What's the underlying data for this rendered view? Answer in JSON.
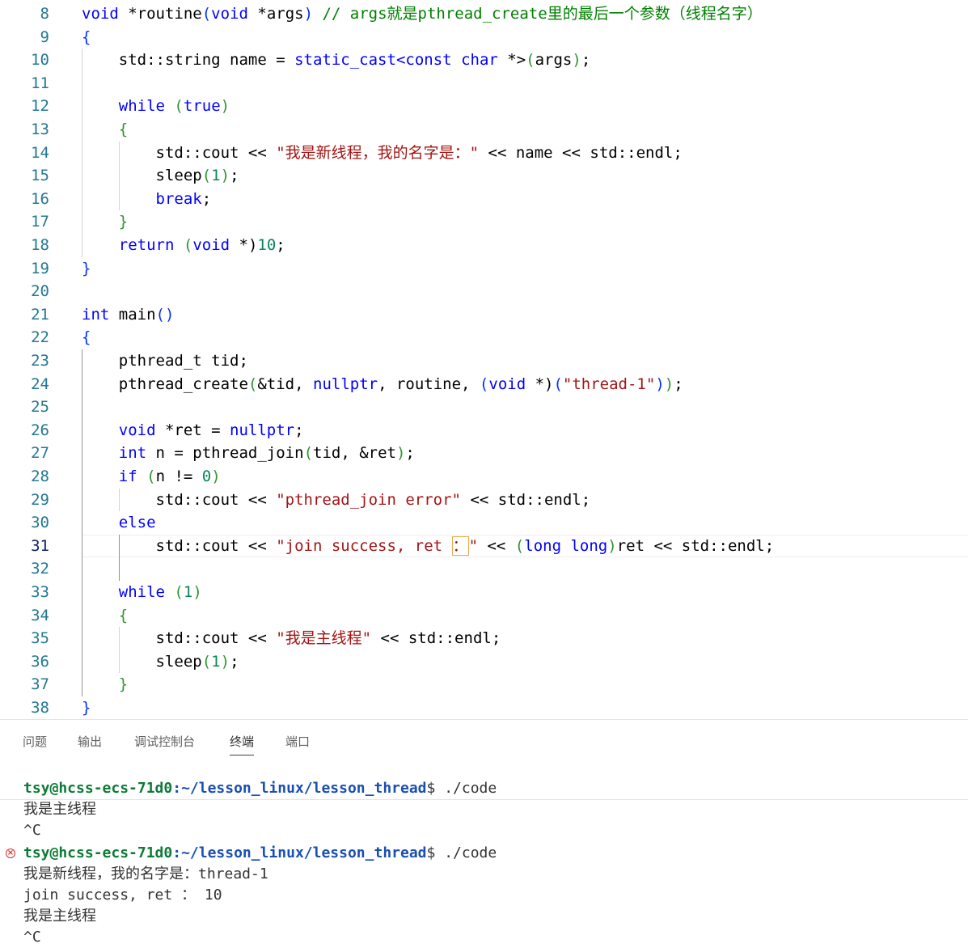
{
  "editor": {
    "lines": [
      {
        "n": "8",
        "tokens": [
          {
            "t": "void",
            "c": "k"
          },
          {
            "t": " *routine"
          },
          {
            "t": "(",
            "c": "b1"
          },
          {
            "t": "void",
            "c": "k"
          },
          {
            "t": " *args"
          },
          {
            "t": ")",
            "c": "b1"
          },
          {
            "t": " // args就是pthread_create里的最后一个参数（线程名字）",
            "c": "c"
          }
        ]
      },
      {
        "n": "9",
        "tokens": [
          {
            "t": "{",
            "c": "b1"
          }
        ]
      },
      {
        "n": "10",
        "tokens": [
          {
            "t": "    std::string name = "
          },
          {
            "t": "static_cast",
            "c": "k"
          },
          {
            "t": "<",
            "c": "k"
          },
          {
            "t": "const",
            "c": "k"
          },
          {
            "t": " "
          },
          {
            "t": "char",
            "c": "k"
          },
          {
            "t": " *>"
          },
          {
            "t": "(",
            "c": "b2"
          },
          {
            "t": "args"
          },
          {
            "t": ")",
            "c": "b2"
          },
          {
            "t": ";"
          }
        ]
      },
      {
        "n": "11",
        "tokens": []
      },
      {
        "n": "12",
        "tokens": [
          {
            "t": "    "
          },
          {
            "t": "while",
            "c": "k"
          },
          {
            "t": " "
          },
          {
            "t": "(",
            "c": "b2"
          },
          {
            "t": "true",
            "c": "k"
          },
          {
            "t": ")",
            "c": "b2"
          }
        ]
      },
      {
        "n": "13",
        "tokens": [
          {
            "t": "    "
          },
          {
            "t": "{",
            "c": "b2"
          }
        ]
      },
      {
        "n": "14",
        "tokens": [
          {
            "t": "        std::cout << "
          },
          {
            "t": "\"我是新线程，我的名字是：\"",
            "c": "s"
          },
          {
            "t": " << name << std::endl;"
          }
        ]
      },
      {
        "n": "15",
        "tokens": [
          {
            "t": "        sleep"
          },
          {
            "t": "(",
            "c": "b2"
          },
          {
            "t": "1",
            "c": "n"
          },
          {
            "t": ")",
            "c": "b2"
          },
          {
            "t": ";"
          }
        ]
      },
      {
        "n": "16",
        "tokens": [
          {
            "t": "        "
          },
          {
            "t": "break",
            "c": "k"
          },
          {
            "t": ";"
          }
        ]
      },
      {
        "n": "17",
        "tokens": [
          {
            "t": "    "
          },
          {
            "t": "}",
            "c": "b2"
          }
        ]
      },
      {
        "n": "18",
        "tokens": [
          {
            "t": "    "
          },
          {
            "t": "return",
            "c": "k"
          },
          {
            "t": " "
          },
          {
            "t": "(",
            "c": "b2"
          },
          {
            "t": "void",
            "c": "k"
          },
          {
            "t": " *)"
          },
          {
            "t": "10",
            "c": "n"
          },
          {
            "t": ";"
          }
        ]
      },
      {
        "n": "19",
        "tokens": [
          {
            "t": "}",
            "c": "b1"
          }
        ]
      },
      {
        "n": "20",
        "tokens": []
      },
      {
        "n": "21",
        "tokens": [
          {
            "t": "int",
            "c": "k"
          },
          {
            "t": " main"
          },
          {
            "t": "()",
            "c": "b1"
          }
        ]
      },
      {
        "n": "22",
        "tokens": [
          {
            "t": "{",
            "c": "b1"
          }
        ]
      },
      {
        "n": "23",
        "tokens": [
          {
            "t": "    pthread_t tid;"
          }
        ]
      },
      {
        "n": "24",
        "tokens": [
          {
            "t": "    pthread_create"
          },
          {
            "t": "(",
            "c": "b2"
          },
          {
            "t": "&tid, "
          },
          {
            "t": "nullptr",
            "c": "k"
          },
          {
            "t": ", routine, "
          },
          {
            "t": "(",
            "c": "b1"
          },
          {
            "t": "void",
            "c": "k"
          },
          {
            "t": " *)"
          },
          {
            "t": "(",
            "c": "b1"
          },
          {
            "t": "\"thread-1\"",
            "c": "s"
          },
          {
            "t": ")",
            "c": "b1"
          },
          {
            "t": ")",
            "c": "b2"
          },
          {
            "t": ";"
          }
        ]
      },
      {
        "n": "25",
        "tokens": []
      },
      {
        "n": "26",
        "tokens": [
          {
            "t": "    "
          },
          {
            "t": "void",
            "c": "k"
          },
          {
            "t": " *ret = "
          },
          {
            "t": "nullptr",
            "c": "k"
          },
          {
            "t": ";"
          }
        ]
      },
      {
        "n": "27",
        "tokens": [
          {
            "t": "    "
          },
          {
            "t": "int",
            "c": "k"
          },
          {
            "t": " n = pthread_join"
          },
          {
            "t": "(",
            "c": "b2"
          },
          {
            "t": "tid, &ret"
          },
          {
            "t": ")",
            "c": "b2"
          },
          {
            "t": ";"
          }
        ]
      },
      {
        "n": "28",
        "tokens": [
          {
            "t": "    "
          },
          {
            "t": "if",
            "c": "k"
          },
          {
            "t": " "
          },
          {
            "t": "(",
            "c": "b2"
          },
          {
            "t": "n != "
          },
          {
            "t": "0",
            "c": "n"
          },
          {
            "t": ")",
            "c": "b2"
          }
        ]
      },
      {
        "n": "29",
        "tokens": [
          {
            "t": "        std::cout << "
          },
          {
            "t": "\"pthread_join error\"",
            "c": "s"
          },
          {
            "t": " << std::endl;"
          }
        ]
      },
      {
        "n": "30",
        "tokens": [
          {
            "t": "    "
          },
          {
            "t": "else",
            "c": "k"
          }
        ]
      },
      {
        "n": "31",
        "tokens": [
          {
            "t": "        std::cout << "
          },
          {
            "t": "\"join success, ret ",
            "c": "s"
          },
          {
            "t": "：",
            "c": "s",
            "box": true
          },
          {
            "t": "\"",
            "c": "s"
          },
          {
            "t": " << "
          },
          {
            "t": "(",
            "c": "b2"
          },
          {
            "t": "long",
            "c": "k"
          },
          {
            "t": " "
          },
          {
            "t": "long",
            "c": "k"
          },
          {
            "t": ")",
            "c": "b2"
          },
          {
            "t": "ret << std::endl;"
          }
        ]
      },
      {
        "n": "32",
        "tokens": []
      },
      {
        "n": "33",
        "tokens": [
          {
            "t": "    "
          },
          {
            "t": "while",
            "c": "k"
          },
          {
            "t": " "
          },
          {
            "t": "(",
            "c": "b2"
          },
          {
            "t": "1",
            "c": "n"
          },
          {
            "t": ")",
            "c": "b2"
          }
        ]
      },
      {
        "n": "34",
        "tokens": [
          {
            "t": "    "
          },
          {
            "t": "{",
            "c": "b2"
          }
        ]
      },
      {
        "n": "35",
        "tokens": [
          {
            "t": "        std::cout << "
          },
          {
            "t": "\"我是主线程\"",
            "c": "s"
          },
          {
            "t": " << std::endl;"
          }
        ]
      },
      {
        "n": "36",
        "tokens": [
          {
            "t": "        sleep"
          },
          {
            "t": "(",
            "c": "b2"
          },
          {
            "t": "1",
            "c": "n"
          },
          {
            "t": ")",
            "c": "b2"
          },
          {
            "t": ";"
          }
        ]
      },
      {
        "n": "37",
        "tokens": [
          {
            "t": "    "
          },
          {
            "t": "}",
            "c": "b2"
          }
        ]
      },
      {
        "n": "38",
        "tokens": [
          {
            "t": "}",
            "c": "b1"
          }
        ]
      }
    ],
    "active_line": "31"
  },
  "panel": {
    "tabs": [
      {
        "label": "问题",
        "active": false
      },
      {
        "label": "输出",
        "active": false
      },
      {
        "label": "调试控制台",
        "active": false
      },
      {
        "label": "终端",
        "active": true
      },
      {
        "label": "端口",
        "active": false
      }
    ]
  },
  "terminal": {
    "prompt_user": "tsy@hcss-ecs-71d0",
    "prompt_path": ":~/lesson_linux/lesson_thread",
    "prompt_symbol": "$ ",
    "command": "./code",
    "error_icon": "error-circle-icon",
    "lines": [
      {
        "type": "prompt"
      },
      {
        "type": "out",
        "text": "我是主线程"
      },
      {
        "type": "out",
        "text": "^C"
      },
      {
        "type": "prompt",
        "error": true
      },
      {
        "type": "out",
        "text": "我是新线程，我的名字是：thread-1"
      },
      {
        "type": "out",
        "text": "join success, ret ： 10"
      },
      {
        "type": "out",
        "text": "我是主线程"
      },
      {
        "type": "out",
        "text": "^C"
      }
    ]
  }
}
